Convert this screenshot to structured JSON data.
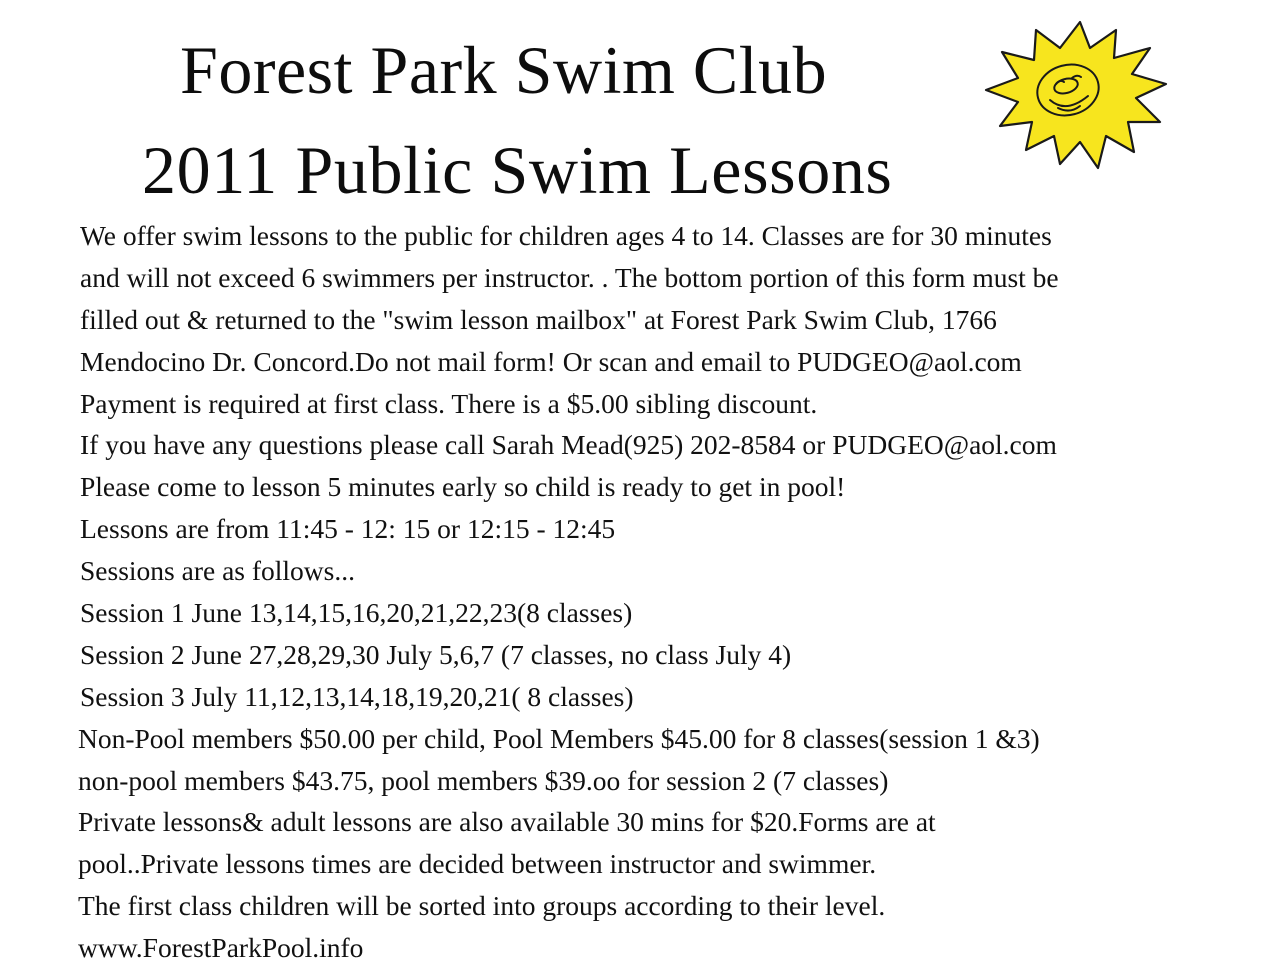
{
  "header": {
    "title_line_1": "Forest Park Swim Club",
    "title_line_2": "2011 Public Swim Lessons"
  },
  "logo": {
    "icon": "smiling-sun-icon",
    "fill_color": "#f7e51e",
    "stroke_color": "#1a1a1a"
  },
  "body": {
    "lines": [
      "We offer swim lessons to the public for children ages 4 to 14. Classes are for 30 minutes",
      "and will not exceed 6 swimmers per instructor. . The bottom portion of this form must be",
      "filled out & returned  to the \"swim lesson mailbox\" at Forest Park Swim Club, 1766",
      "Mendocino Dr. Concord.Do not mail form! Or scan and email to PUDGEO@aol.com",
      "Payment is required at first class.  There is a $5.00 sibling discount.",
      "If you have any questions please call Sarah Mead(925) 202-8584 or PUDGEO@aol.com",
      "Please come to lesson 5 minutes early so child is ready to get in pool!",
      "Lessons are from 11:45 - 12: 15 or 12:15 - 12:45",
      "Sessions are as follows...",
      "Session 1  June 13,14,15,16,20,21,22,23(8 classes)",
      "Session 2 June 27,28,29,30 July 5,6,7 (7 classes, no class July 4)",
      "Session 3 July 11,12,13,14,18,19,20,21( 8 classes)",
      "Non-Pool members $50.00 per child, Pool Members $45.00 for 8 classes(session 1 &3)",
      "non-pool members $43.75, pool members $39.oo for session 2 (7 classes)",
      "Private lessons& adult lessons are also available 30 mins for $20.Forms are at",
      "pool..Private lessons times are decided between instructor and swimmer.",
      "The first class children will be sorted into groups  according to their level.",
      "www.ForestParkPool.info"
    ]
  }
}
